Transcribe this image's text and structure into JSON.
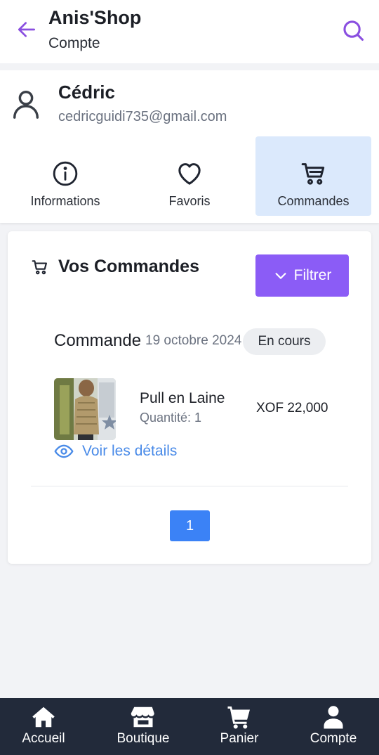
{
  "appbar": {
    "title": "Anis'Shop",
    "subtitle": "Compte",
    "back_icon": "arrow-left-icon",
    "search_icon": "search-icon",
    "accent": "#8a4fe0"
  },
  "profile": {
    "name": "Cédric",
    "email": "cedricguidi735@gmail.com",
    "avatar_icon": "user-icon"
  },
  "tabs": [
    {
      "label": "Informations",
      "icon": "info-icon",
      "active": false
    },
    {
      "label": "Favoris",
      "icon": "heart-icon",
      "active": false
    },
    {
      "label": "Commandes",
      "icon": "cart-icon",
      "active": true
    }
  ],
  "orders": {
    "heading": "Vos Commandes",
    "filter_label": "Filtrer",
    "order_label": "Commande",
    "order_date": "19 octobre 2024",
    "status": "En cours",
    "item": {
      "name": "Pull en Laine",
      "quantity": "Quantité: 1",
      "price": "XOF 22,000"
    },
    "details_link": "Voir les détails",
    "page": "1"
  },
  "colors": {
    "filter_button": "#8b5cf6",
    "page_button": "#3b82f6",
    "link": "#4a8be8",
    "active_tab": "#dbe9fc",
    "bottom_nav": "#222a3a"
  },
  "bottom_nav": [
    {
      "label": "Accueil",
      "icon": "home-icon"
    },
    {
      "label": "Boutique",
      "icon": "store-icon"
    },
    {
      "label": "Panier",
      "icon": "cart-icon"
    },
    {
      "label": "Compte",
      "icon": "user-icon"
    }
  ]
}
